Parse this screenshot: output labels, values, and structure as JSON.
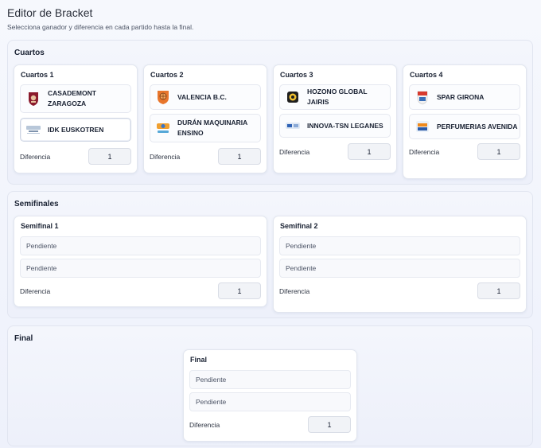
{
  "page": {
    "title": "Editor de Bracket",
    "subtitle": "Selecciona ganador y diferencia en cada partido hasta la final."
  },
  "diff_label": "Diferencia",
  "quarters": {
    "title": "Cuartos",
    "matches": [
      {
        "title": "Cuartos 1",
        "teams": [
          {
            "name": "CASADEMONT ZARAGOZA",
            "logo": "casademont-logo"
          },
          {
            "name": "IDK EUSKOTREN",
            "logo": "euskotren-logo"
          }
        ],
        "diff": "1"
      },
      {
        "title": "Cuartos 2",
        "teams": [
          {
            "name": "VALENCIA B.C.",
            "logo": "valencia-logo"
          },
          {
            "name": "DURÁN MAQUINARIA ENSINO",
            "logo": "ensino-logo"
          }
        ],
        "diff": "1"
      },
      {
        "title": "Cuartos 3",
        "teams": [
          {
            "name": "HOZONO GLOBAL JAIRIS",
            "logo": "jairis-logo"
          },
          {
            "name": "INNOVA-TSN LEGANES",
            "logo": "leganes-logo"
          }
        ],
        "diff": "1"
      },
      {
        "title": "Cuartos 4",
        "teams": [
          {
            "name": "SPAR GIRONA",
            "logo": "girona-logo"
          },
          {
            "name": "PERFUMERIAS AVENIDA",
            "logo": "avenida-logo"
          }
        ],
        "diff": "1"
      }
    ]
  },
  "semis": {
    "title": "Semifinales",
    "matches": [
      {
        "title": "Semifinal 1",
        "slots": [
          "Pendiente",
          "Pendiente"
        ],
        "diff": "1"
      },
      {
        "title": "Semifinal 2",
        "slots": [
          "Pendiente",
          "Pendiente"
        ],
        "diff": "1"
      }
    ]
  },
  "final": {
    "title": "Final",
    "match": {
      "title": "Final",
      "slots": [
        "Pendiente",
        "Pendiente"
      ],
      "diff": "1"
    }
  },
  "colors": {
    "accent_dark": "#1a2233",
    "card_bg": "#ffffff",
    "section_bg": "#f0f3fb"
  }
}
